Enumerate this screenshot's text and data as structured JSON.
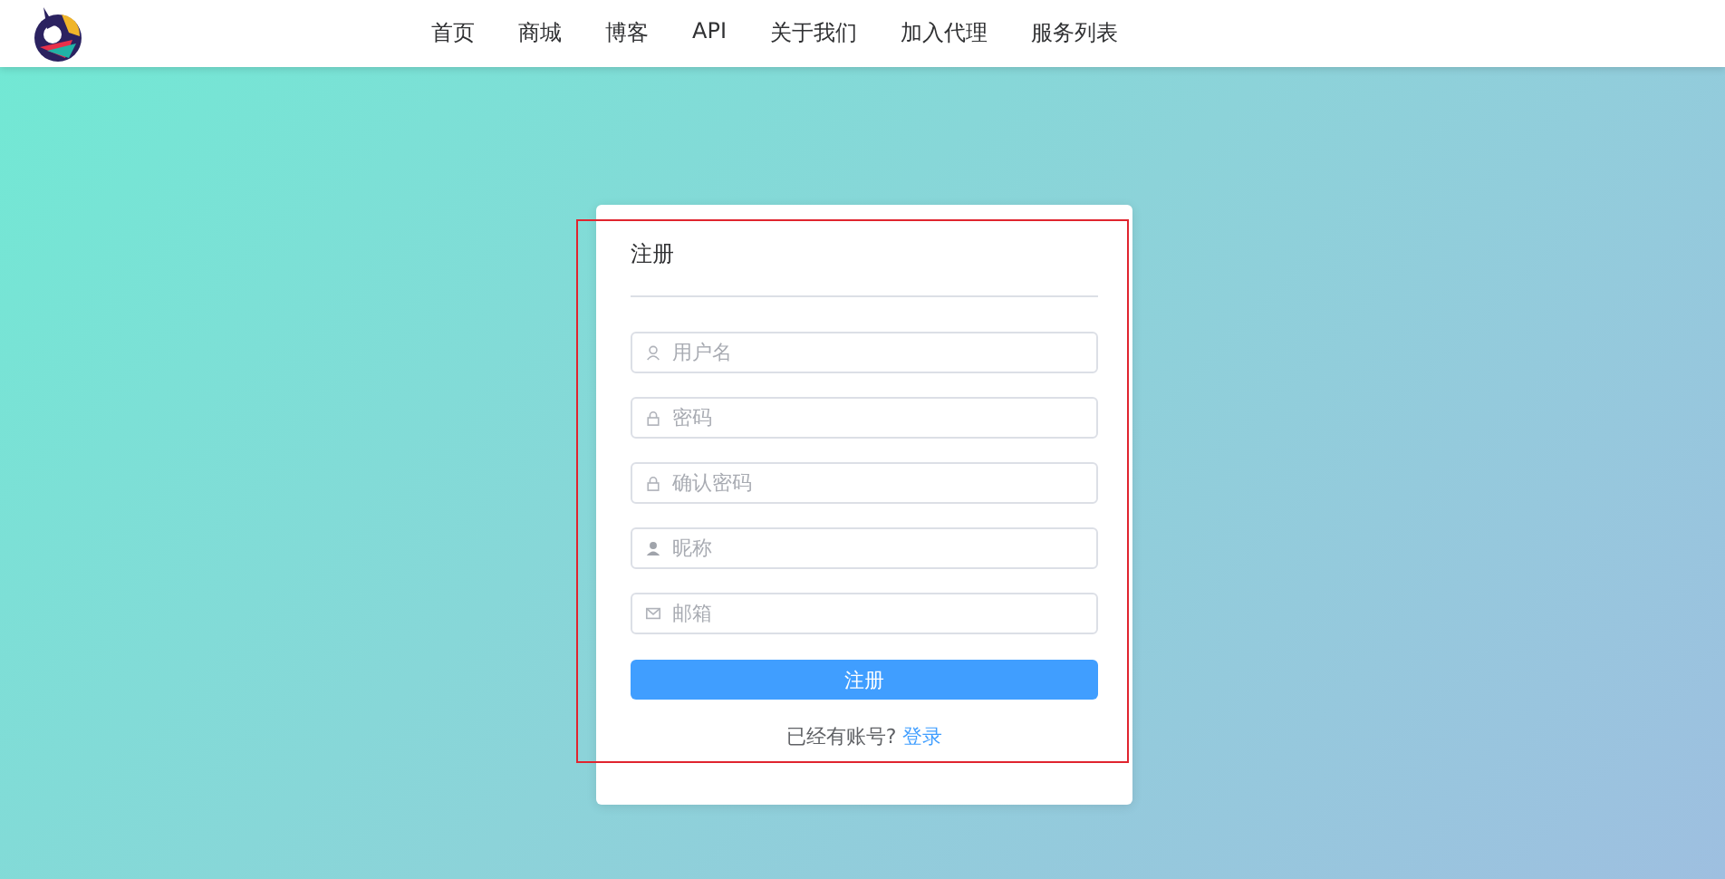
{
  "nav": [
    "首页",
    "商城",
    "博客",
    "API",
    "关于我们",
    "加入代理",
    "服务列表"
  ],
  "form": {
    "title": "注册",
    "fields": [
      {
        "kind": "user",
        "placeholder": "用户名"
      },
      {
        "kind": "lock",
        "placeholder": "密码"
      },
      {
        "kind": "lock",
        "placeholder": "确认密码"
      },
      {
        "kind": "person",
        "placeholder": "昵称"
      },
      {
        "kind": "mail",
        "placeholder": "邮箱"
      }
    ],
    "submit": "注册",
    "prompt": "已经有账号?",
    "link": "登录"
  }
}
